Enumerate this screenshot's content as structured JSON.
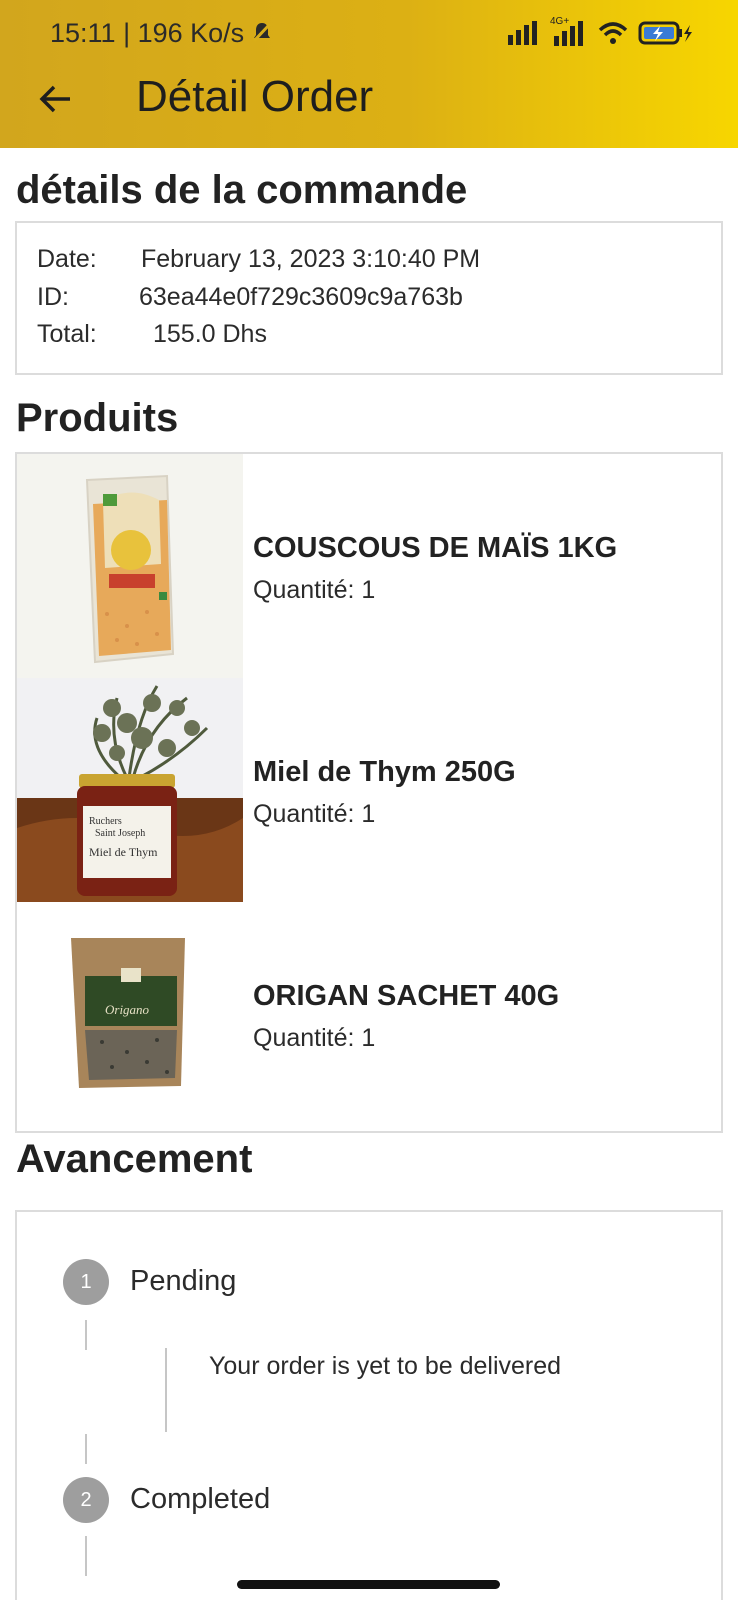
{
  "status_bar": {
    "time": "15:11 | 196 Ko/s",
    "network_label": "4G+"
  },
  "app_bar": {
    "title": "Détail Order"
  },
  "order_details": {
    "heading": "détails de la commande",
    "date_label": "Date:",
    "date_value": "February 13, 2023 3:10:40 PM",
    "id_label": "ID:",
    "id_value": "63ea44e0f729c3609c9a763b",
    "total_label": "Total:",
    "total_value": "155.0 Dhs"
  },
  "products": {
    "heading": "Produits",
    "items": [
      {
        "name": "COUSCOUS DE MAÏS 1KG",
        "quantity": "Quantité: 1"
      },
      {
        "name": "Miel de Thym 250G",
        "quantity": "Quantité: 1",
        "jar_label_line1": "Ruchers",
        "jar_label_line2": "Saint Joseph",
        "jar_label_name": "Miel de Thym"
      },
      {
        "name": "ORIGAN SACHET 40G",
        "quantity": "Quantité: 1",
        "pack_label": "Origano"
      }
    ]
  },
  "progress": {
    "heading": "Avancement",
    "steps": [
      {
        "number": "1",
        "title": "Pending",
        "content": "Your order is yet to be delivered"
      },
      {
        "number": "2",
        "title": "Completed"
      }
    ]
  },
  "colors": {
    "appbar_start": "#d2a61d",
    "appbar_end": "#f7d600",
    "step_circle": "#9e9e9e",
    "card_border": "#dcdcdc"
  }
}
